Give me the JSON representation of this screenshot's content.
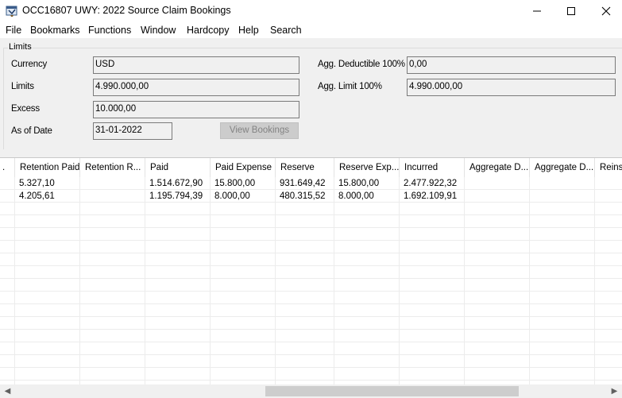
{
  "window": {
    "title": "OCC16807 UWY: 2022 Source Claim Bookings",
    "minimize_glyph": "—",
    "maximize_glyph": "☐",
    "close_glyph": "✕"
  },
  "menu": {
    "items": [
      "File",
      "Bookmarks",
      "Functions",
      "Window",
      "Hardcopy",
      "Help",
      "Search"
    ]
  },
  "limits": {
    "group_label": "Limits",
    "currency_label": "Currency",
    "currency_value": "USD",
    "limits_label": "Limits",
    "limits_value": "4.990.000,00",
    "excess_label": "Excess",
    "excess_value": "10.000,00",
    "as_of_date_label": "As of Date",
    "as_of_date_value": "31-01-2022",
    "view_bookings_label": "View Bookings",
    "agg_deductible_label": "Agg. Deductible 100%",
    "agg_deductible_value": "0,00",
    "agg_limit_label": "Agg. Limit 100%",
    "agg_limit_value": "4.990.000,00"
  },
  "grid": {
    "columns": [
      ".",
      "Retention Paid",
      "Retention R...",
      "Paid",
      "Paid Expense",
      "Reserve",
      "Reserve Exp...",
      "Incurred",
      "Aggregate D...",
      "Aggregate D...",
      "Reinst"
    ],
    "rows": [
      [
        "",
        "5.327,10",
        "",
        "1.514.672,90",
        "15.800,00",
        "931.649,42",
        "15.800,00",
        "2.477.922,32",
        "",
        "",
        ""
      ],
      [
        "",
        "4.205,61",
        "",
        "1.195.794,39",
        "8.000,00",
        "480.315,52",
        "8.000,00",
        "1.692.109,91",
        "",
        "",
        ""
      ]
    ],
    "scroll_left_glyph": "◀",
    "scroll_right_glyph": "▶"
  },
  "colors": {
    "panel_bg": "#f0f0f0",
    "disabled_button_bg": "#cccccc",
    "disabled_button_text": "#838383"
  }
}
